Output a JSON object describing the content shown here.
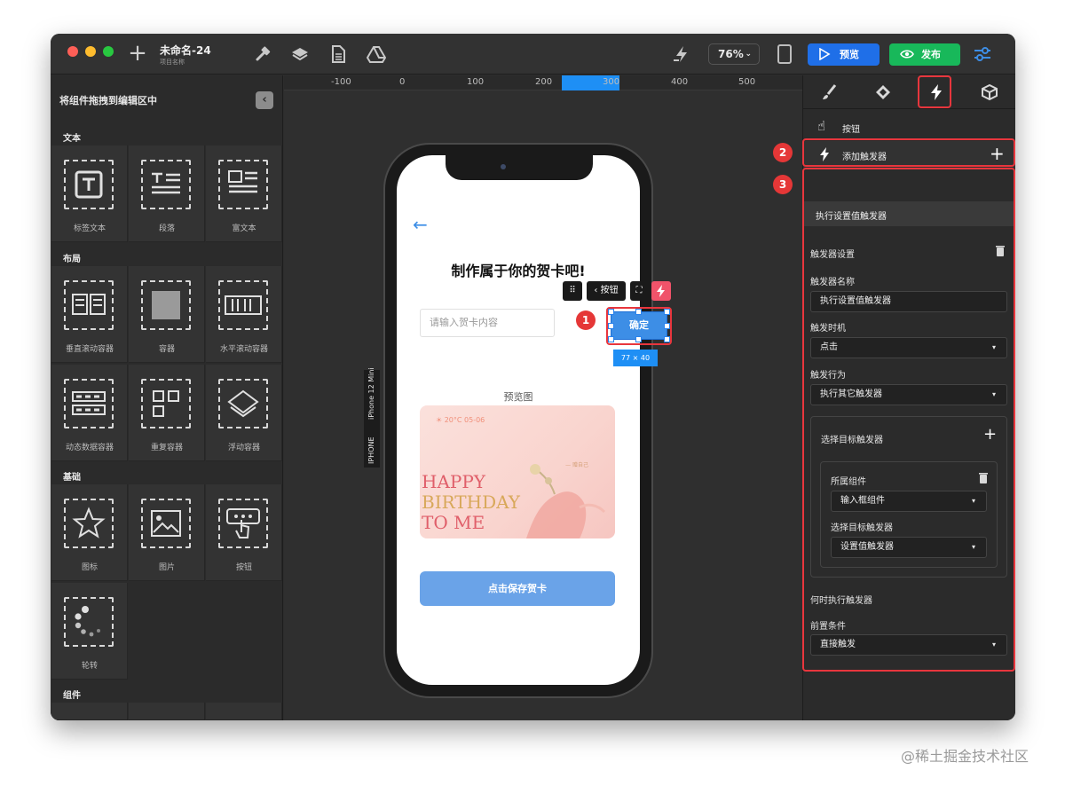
{
  "titlebar": {
    "doc_title": "未命名-24",
    "doc_subtitle": "项目名称",
    "zoom": "76%",
    "preview_label": "预览",
    "publish_label": "发布"
  },
  "left_panel": {
    "header": "将组件拖拽到编辑区中",
    "sections": {
      "text": "文本",
      "layout": "布局",
      "basic": "基础",
      "components": "组件"
    },
    "items": {
      "label_text": "标签文本",
      "paragraph": "段落",
      "rich_text": "富文本",
      "vertical_scroll": "垂直滚动容器",
      "container": "容器",
      "horizontal_scroll": "水平滚动容器",
      "dynamic_data": "动态数据容器",
      "repeat_container": "重复容器",
      "float_container": "浮动容器",
      "icon": "图标",
      "image": "图片",
      "button": "按钮",
      "carousel": "轮转"
    }
  },
  "ruler": {
    "ticks": [
      "-100",
      "0",
      "100",
      "200",
      "300",
      "400",
      "500"
    ]
  },
  "phone": {
    "title": "制作属于你的贺卡吧!",
    "input_placeholder": "请输入贺卡内容",
    "confirm_label": "确定",
    "preview_label": "预览图",
    "card_date": "20°C 05-06",
    "card_small": "— 赠自己",
    "card_line1": "HAPPY",
    "card_line2": "BIRTHDAY",
    "card_line3": "TO ME",
    "save_label": "点击保存贺卡",
    "device_name": "iPhone 12 Mini",
    "device_type": "IPHONE"
  },
  "selection": {
    "toolbar_label": "按钮",
    "size": "77 × 40"
  },
  "annotations": {
    "n1": "1",
    "n2": "2",
    "n3": "3"
  },
  "right_panel": {
    "component_name": "按钮",
    "add_trigger": "添加触发器",
    "trigger_header": "执行设置值触发器",
    "trigger_settings": "触发器设置",
    "trigger_name_label": "触发器名称",
    "trigger_name_value": "执行设置值触发器",
    "timing_label": "触发时机",
    "timing_value": "点击",
    "action_label": "触发行为",
    "action_value": "执行其它触发器",
    "target_label": "选择目标触发器",
    "owner_label": "所属组件",
    "owner_value": "输入框组件",
    "target_inner_label": "选择目标触发器",
    "target_inner_value": "设置值触发器",
    "when_label": "何时执行触发器",
    "precondition_label": "前置条件",
    "precondition_value": "直接触发"
  },
  "watermark": "@稀土掘金技术社区",
  "colors": {
    "accent_blue": "#1f6fe8",
    "publish_green": "#18b85a",
    "annotation_red": "#e53737"
  }
}
